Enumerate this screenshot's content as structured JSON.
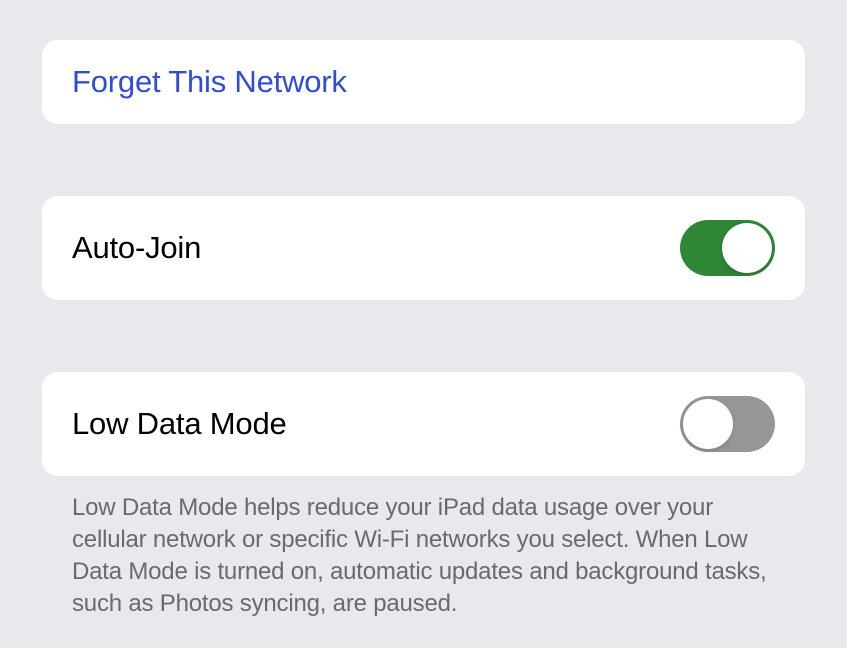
{
  "forget": {
    "label": "Forget This Network"
  },
  "autoJoin": {
    "label": "Auto-Join",
    "enabled": true
  },
  "lowDataMode": {
    "label": "Low Data Mode",
    "enabled": false,
    "description": "Low Data Mode helps reduce your iPad data usage over your cellular network or specific Wi-Fi networks you select. When Low Data Mode is turned on, automatic updates and background tasks, such as Photos syncing, are paused."
  }
}
